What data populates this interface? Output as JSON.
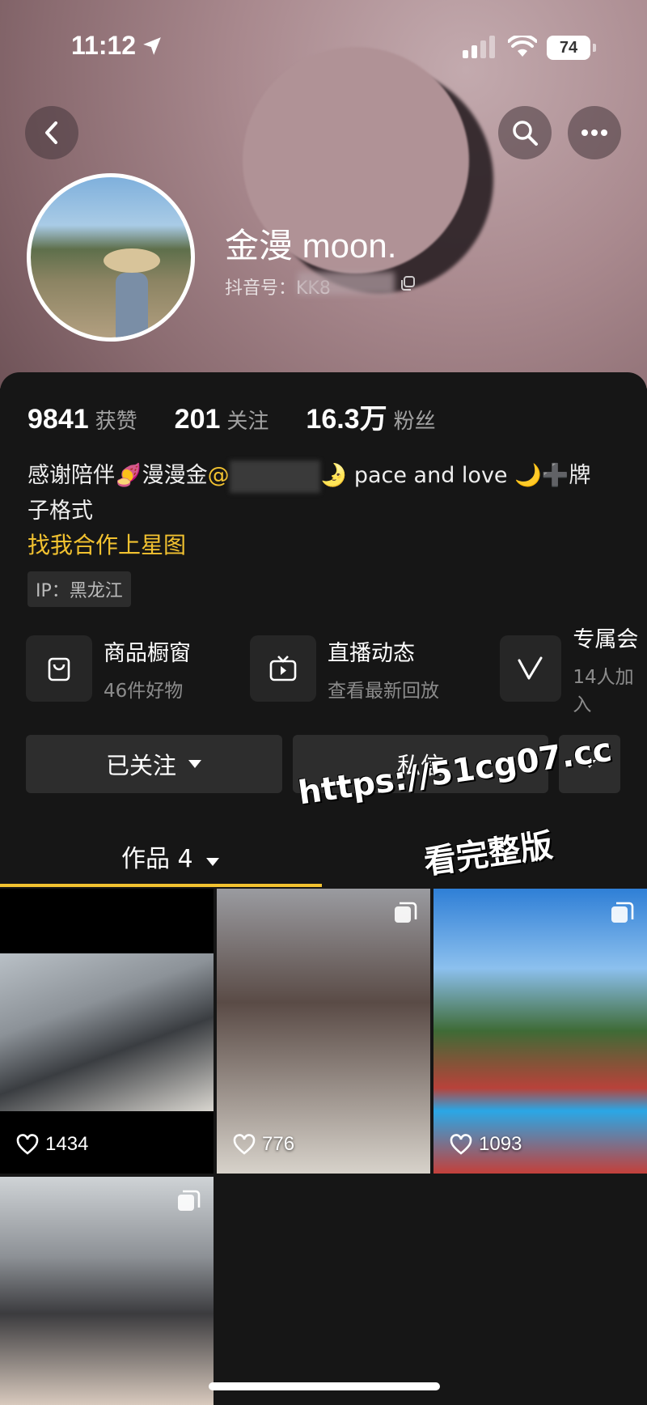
{
  "status_bar": {
    "time": "11:12",
    "battery": "74"
  },
  "profile": {
    "name": "金漫 moon.",
    "douyin_id_label": "抖音号：KK8",
    "stats": [
      {
        "value": "9841",
        "label": "获赞"
      },
      {
        "value": "201",
        "label": "关注"
      },
      {
        "value": "16.3万",
        "label": "粉丝"
      }
    ],
    "bio_line1_a": "感谢陪伴🍠漫漫金",
    "bio_mention_prefix": "@",
    "bio_line1_b": "🌛 pace and love 🌙➕牌",
    "bio_line2": "子格式",
    "collab_link": "找我合作上星图",
    "ip_tag": "IP：黑龙江"
  },
  "features": [
    {
      "title": "商品橱窗",
      "subtitle": "46件好物",
      "icon": "shopping-bag-icon"
    },
    {
      "title": "直播动态",
      "subtitle": "查看最新回放",
      "icon": "tv-icon"
    },
    {
      "title": "专属会",
      "subtitle": "14人加入",
      "icon": "v-icon"
    }
  ],
  "actions": {
    "follow": "已关注",
    "message": "私信"
  },
  "tabs": {
    "works": "作品 4"
  },
  "watermark": {
    "line1": "https://51cg07.cc",
    "line2": "看完整版"
  },
  "posts": [
    {
      "likes": "1434",
      "multi": false
    },
    {
      "likes": "776",
      "multi": true
    },
    {
      "likes": "1093",
      "multi": true
    },
    {
      "likes": "",
      "multi": true
    }
  ],
  "colors": {
    "accent": "#f2c230",
    "background": "#161616",
    "button": "#2d2d2d"
  }
}
